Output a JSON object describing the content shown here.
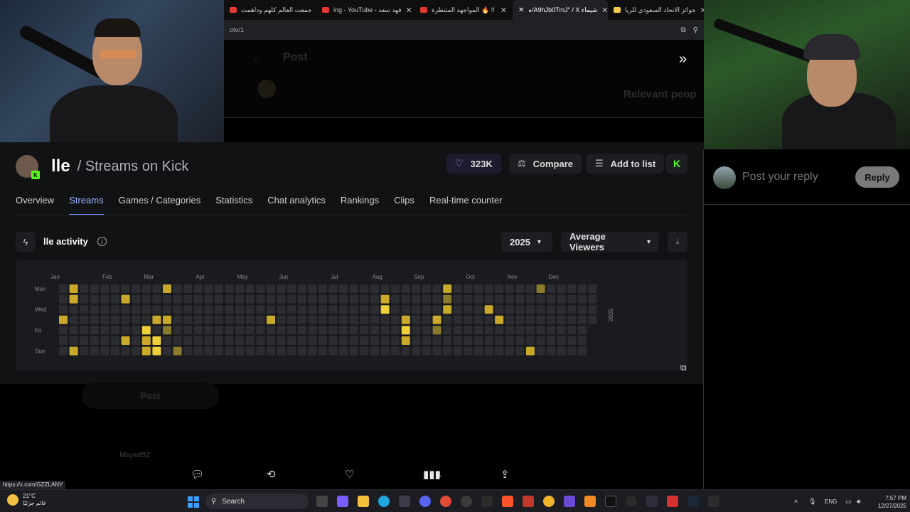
{
  "browser": {
    "tabs": [
      {
        "title": "جمعت العالم كلهم وداهمت",
        "color": "#e53935"
      },
      {
        "title": "ing - YouTube - فهد سعد",
        "color": "#e53935"
      },
      {
        "title": "المواجهة المنتظرة 🔥 !!",
        "color": "#e53935"
      },
      {
        "title": "ه/A9hJb0TmJ\" / X شيماء",
        "color": "#ffffff",
        "active": true
      },
      {
        "title": "جوائز الاتحاد السعودي للريا",
        "color": "#f2c94c"
      }
    ],
    "url": "oto/1",
    "x_page": {
      "post_heading": "Post",
      "relevant_people": "Relevant peop",
      "post_button": "Post",
      "username": "Majed92",
      "actions": {
        "reply_icon": "reply-icon",
        "repost_icon": "repost-icon",
        "like_icon": "heart-icon",
        "views_count": "1",
        "share_icon": "share-icon"
      },
      "reply_placeholder": "Post your reply",
      "reply_button": "Reply",
      "status_url": "https://x.com/GZZLANY"
    }
  },
  "channel": {
    "name": "lle",
    "subtitle": "/ Streams on Kick",
    "likes": "323K",
    "compare_label": "Compare",
    "add_to_list_label": "Add to list",
    "kick_logo": "K"
  },
  "nav_tabs": [
    {
      "label": "Overview"
    },
    {
      "label": "Streams",
      "active": true
    },
    {
      "label": "Games / Categories"
    },
    {
      "label": "Statistics"
    },
    {
      "label": "Chat analytics"
    },
    {
      "label": "Rankings"
    },
    {
      "label": "Clips"
    },
    {
      "label": "Real-time counter"
    }
  ],
  "activity": {
    "title": "lle activity",
    "year": "2025",
    "metric": "Average Viewers"
  },
  "chart_data": {
    "type": "heatmap",
    "year_label": "2025",
    "months": [
      "Jan",
      "Feb",
      "Mar",
      "Apr",
      "May",
      "Jun",
      "Jul",
      "Aug",
      "Sep",
      "Oct",
      "Nov",
      "Dec"
    ],
    "day_labels": [
      "Mon",
      "Wed",
      "Fri",
      "Sun"
    ],
    "weeks": 52,
    "highlight_colors": {
      "empty": "#2c2d31",
      "low": "#8a7a2c",
      "mid": "#c9a82a",
      "high": "#f0d03a"
    },
    "active_cells": [
      {
        "week": 1,
        "day": 0,
        "level": "mid"
      },
      {
        "week": 1,
        "day": 1,
        "level": "mid"
      },
      {
        "week": 0,
        "day": 3,
        "level": "mid"
      },
      {
        "week": 1,
        "day": 6,
        "level": "mid"
      },
      {
        "week": 6,
        "day": 1,
        "level": "mid"
      },
      {
        "week": 6,
        "day": 5,
        "level": "mid"
      },
      {
        "week": 8,
        "day": 4,
        "level": "high"
      },
      {
        "week": 8,
        "day": 5,
        "level": "mid"
      },
      {
        "week": 8,
        "day": 6,
        "level": "mid"
      },
      {
        "week": 9,
        "day": 3,
        "level": "mid"
      },
      {
        "week": 9,
        "day": 5,
        "level": "high"
      },
      {
        "week": 9,
        "day": 6,
        "level": "high"
      },
      {
        "week": 10,
        "day": 0,
        "level": "mid"
      },
      {
        "week": 10,
        "day": 3,
        "level": "mid"
      },
      {
        "week": 10,
        "day": 4,
        "level": "low"
      },
      {
        "week": 11,
        "day": 6,
        "level": "low"
      },
      {
        "week": 20,
        "day": 3,
        "level": "mid"
      },
      {
        "week": 31,
        "day": 1,
        "level": "mid"
      },
      {
        "week": 31,
        "day": 2,
        "level": "high"
      },
      {
        "week": 33,
        "day": 3,
        "level": "mid"
      },
      {
        "week": 33,
        "day": 4,
        "level": "high"
      },
      {
        "week": 33,
        "day": 5,
        "level": "mid"
      },
      {
        "week": 36,
        "day": 3,
        "level": "mid"
      },
      {
        "week": 36,
        "day": 4,
        "level": "low"
      },
      {
        "week": 37,
        "day": 0,
        "level": "mid"
      },
      {
        "week": 37,
        "day": 1,
        "level": "low"
      },
      {
        "week": 37,
        "day": 2,
        "level": "mid"
      },
      {
        "week": 41,
        "day": 2,
        "level": "mid"
      },
      {
        "week": 42,
        "day": 3,
        "level": "mid"
      },
      {
        "week": 45,
        "day": 6,
        "level": "mid"
      },
      {
        "week": 46,
        "day": 0,
        "level": "low"
      }
    ]
  },
  "taskbar": {
    "weather_temp": "21°C",
    "weather_desc": "غائم جزئيًا",
    "search_label": "Search",
    "language": "ENG",
    "time": "7:57 PM",
    "date": "12/27/2025"
  }
}
